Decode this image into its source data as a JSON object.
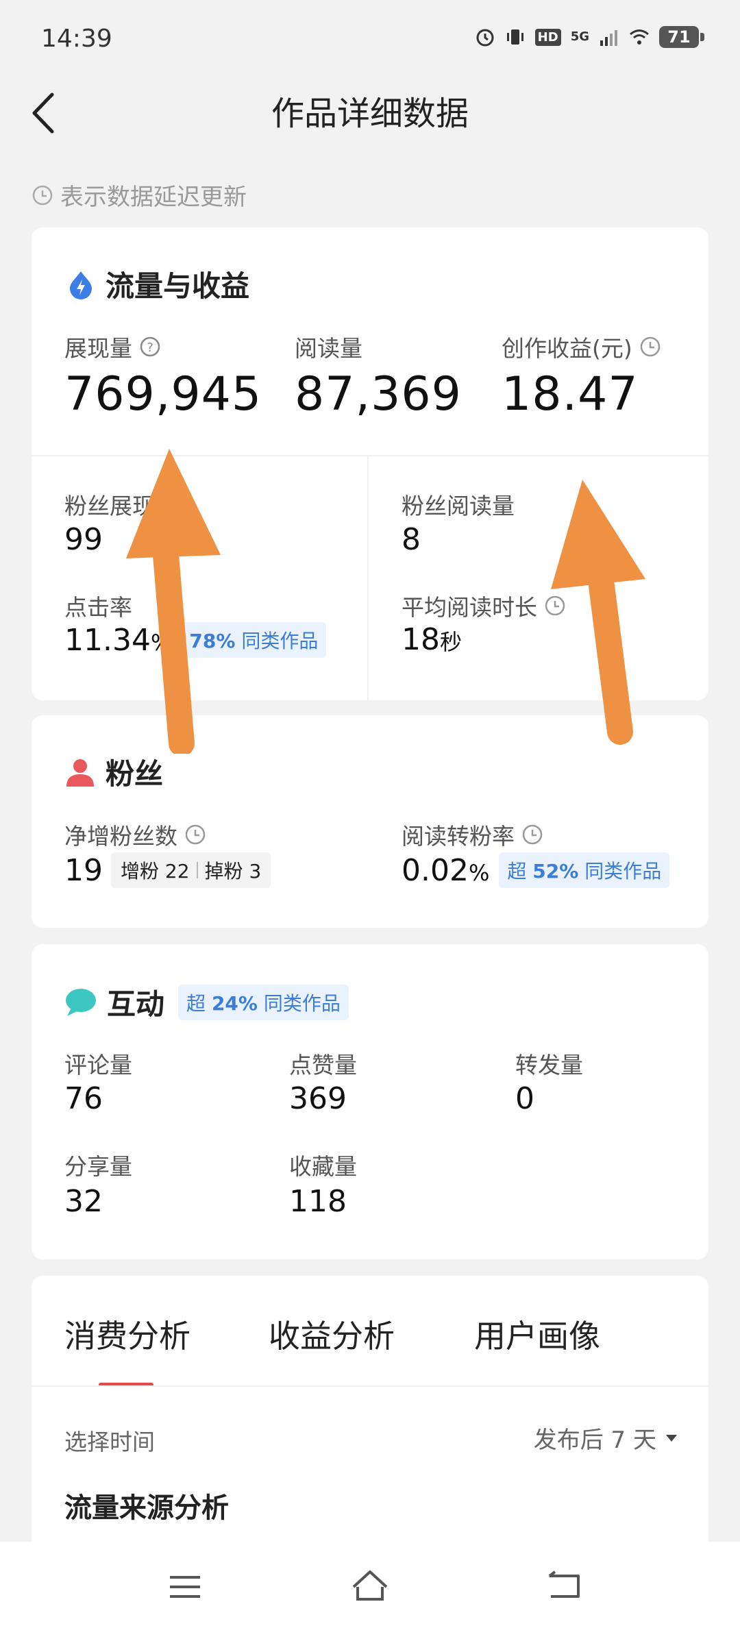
{
  "status": {
    "time": "14:39",
    "battery": "71",
    "hd": "HD",
    "network": "5G"
  },
  "header": {
    "title": "作品详细数据"
  },
  "notice": "表示数据延迟更新",
  "traffic": {
    "title": "流量与收益",
    "impressions_label": "展现量",
    "impressions_value": "769,945",
    "reads_label": "阅读量",
    "reads_value": "87,369",
    "income_label": "创作收益(元)",
    "income_value": "18.47",
    "fan_impressions_label": "粉丝展现",
    "fan_impressions_value": "99",
    "fan_reads_label": "粉丝阅读量",
    "fan_reads_value": "8",
    "ctr_label": "点击率",
    "ctr_value": "11.34",
    "ctr_unit": "%",
    "ctr_badge_pct": "78%",
    "ctr_badge_text": "同类作品",
    "avg_read_label": "平均阅读时长",
    "avg_read_value": "18",
    "avg_read_unit": "秒"
  },
  "fans": {
    "title": "粉丝",
    "net_label": "净增粉丝数",
    "net_value": "19",
    "gain_label": "增粉",
    "gain_value": "22",
    "loss_label": "掉粉",
    "loss_value": "3",
    "conv_label": "阅读转粉率",
    "conv_value": "0.02",
    "conv_unit": "%",
    "conv_badge_prefix": "超",
    "conv_badge_pct": "52%",
    "conv_badge_text": "同类作品"
  },
  "interaction": {
    "title": "互动",
    "badge_prefix": "超",
    "badge_pct": "24%",
    "badge_text": "同类作品",
    "comments_label": "评论量",
    "comments_value": "76",
    "likes_label": "点赞量",
    "likes_value": "369",
    "reposts_label": "转发量",
    "reposts_value": "0",
    "shares_label": "分享量",
    "shares_value": "32",
    "favorites_label": "收藏量",
    "favorites_value": "118"
  },
  "analysis": {
    "tabs": [
      "消费分析",
      "收益分析",
      "用户画像"
    ],
    "select_time_label": "选择时间",
    "select_time_value": "发布后 7 天",
    "source_title": "流量来源分析"
  },
  "colors": {
    "accent": "#e44c4c",
    "badge_blue": "#3b7dd8",
    "arrow": "#ef9143"
  }
}
